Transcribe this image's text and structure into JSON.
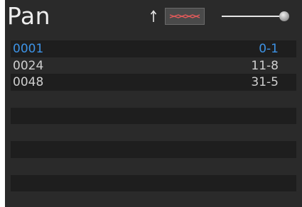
{
  "panel": {
    "title": "Pan"
  },
  "toolbar": {
    "sort_icon": "arrow-up-icon",
    "curve_icon": "curve-icon",
    "slider_level": 0.9
  },
  "colors": {
    "background": "#2a2a2a",
    "row_dark": "#1e1e1e",
    "text": "#cfcfcf",
    "selected": "#3d93e6",
    "curve": "#e35a5a"
  },
  "list": {
    "rows": [
      {
        "id": "0001",
        "value": "0-1"
      },
      {
        "id": "0024",
        "value": "11-8"
      },
      {
        "id": "0048",
        "value": "31-5"
      }
    ]
  }
}
